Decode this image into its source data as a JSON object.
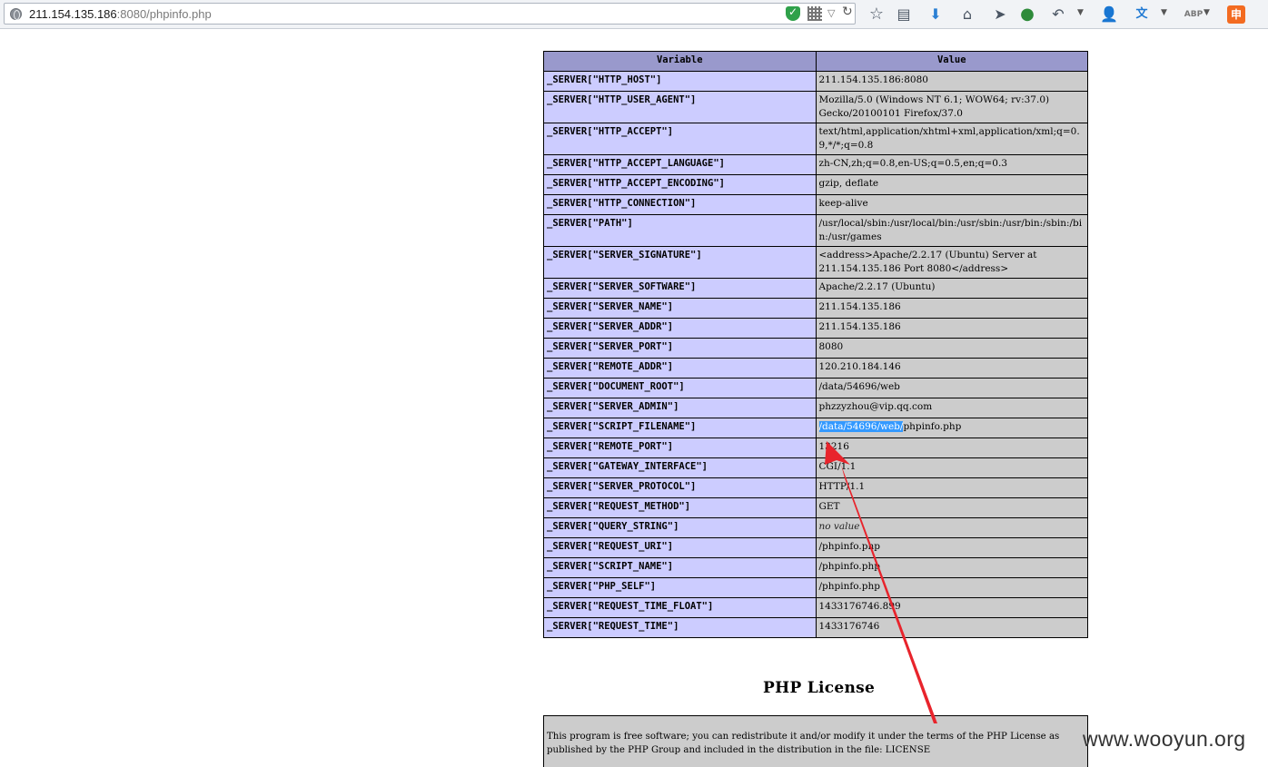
{
  "browser": {
    "url_host": "211.154.135.186",
    "url_rest": ":8080/phpinfo.php"
  },
  "server_table": {
    "headers": [
      "Variable",
      "Value"
    ],
    "rows": [
      {
        "var": "_SERVER[\"HTTP_HOST\"]",
        "val": "211.154.135.186:8080"
      },
      {
        "var": "_SERVER[\"HTTP_USER_AGENT\"]",
        "val": "Mozilla/5.0 (Windows NT 6.1; WOW64; rv:37.0) Gecko/20100101 Firefox/37.0"
      },
      {
        "var": "_SERVER[\"HTTP_ACCEPT\"]",
        "val": "text/html,application/xhtml+xml,application/xml;q=0.9,*/*;q=0.8"
      },
      {
        "var": "_SERVER[\"HTTP_ACCEPT_LANGUAGE\"]",
        "val": "zh-CN,zh;q=0.8,en-US;q=0.5,en;q=0.3"
      },
      {
        "var": "_SERVER[\"HTTP_ACCEPT_ENCODING\"]",
        "val": "gzip, deflate"
      },
      {
        "var": "_SERVER[\"HTTP_CONNECTION\"]",
        "val": "keep-alive"
      },
      {
        "var": "_SERVER[\"PATH\"]",
        "val": "/usr/local/sbin:/usr/local/bin:/usr/sbin:/usr/bin:/sbin:/bin:/usr/games"
      },
      {
        "var": "_SERVER[\"SERVER_SIGNATURE\"]",
        "val": "<address>Apache/2.2.17 (Ubuntu) Server at 211.154.135.186 Port 8080</address>"
      },
      {
        "var": "_SERVER[\"SERVER_SOFTWARE\"]",
        "val": "Apache/2.2.17 (Ubuntu)"
      },
      {
        "var": "_SERVER[\"SERVER_NAME\"]",
        "val": "211.154.135.186"
      },
      {
        "var": "_SERVER[\"SERVER_ADDR\"]",
        "val": "211.154.135.186"
      },
      {
        "var": "_SERVER[\"SERVER_PORT\"]",
        "val": "8080"
      },
      {
        "var": "_SERVER[\"REMOTE_ADDR\"]",
        "val": "120.210.184.146"
      },
      {
        "var": "_SERVER[\"DOCUMENT_ROOT\"]",
        "val": "/data/54696/web"
      },
      {
        "var": "_SERVER[\"SERVER_ADMIN\"]",
        "val": "phzzyzhou@vip.qq.com"
      },
      {
        "var": "_SERVER[\"SCRIPT_FILENAME\"]",
        "val_selected": "/data/54696/web/",
        "val_rest": "phpinfo.php"
      },
      {
        "var": "_SERVER[\"REMOTE_PORT\"]",
        "val": "13216"
      },
      {
        "var": "_SERVER[\"GATEWAY_INTERFACE\"]",
        "val": "CGI/1.1"
      },
      {
        "var": "_SERVER[\"SERVER_PROTOCOL\"]",
        "val": "HTTP/1.1"
      },
      {
        "var": "_SERVER[\"REQUEST_METHOD\"]",
        "val": "GET"
      },
      {
        "var": "_SERVER[\"QUERY_STRING\"]",
        "val_italic": "no value"
      },
      {
        "var": "_SERVER[\"REQUEST_URI\"]",
        "val": "/phpinfo.php"
      },
      {
        "var": "_SERVER[\"SCRIPT_NAME\"]",
        "val": "/phpinfo.php"
      },
      {
        "var": "_SERVER[\"PHP_SELF\"]",
        "val": "/phpinfo.php"
      },
      {
        "var": "_SERVER[\"REQUEST_TIME_FLOAT\"]",
        "val": "1433176746.899"
      },
      {
        "var": "_SERVER[\"REQUEST_TIME\"]",
        "val": "1433176746"
      }
    ]
  },
  "license": {
    "title": "PHP License",
    "text": "This program is free software; you can redistribute it and/or modify it under the terms of the PHP License as published by the PHP Group and included in the distribution in the file: LICENSE"
  },
  "watermark": "www.wooyun.org",
  "colors": {
    "header_bg": "#9999cc",
    "var_bg": "#ccccff",
    "val_bg": "#cccccc",
    "selection": "#3399ff",
    "arrow": "#e8242c"
  },
  "icons": [
    "globe-icon",
    "shield-icon",
    "qr-code-icon",
    "dropmarker-icon",
    "reload-icon",
    "bookmark-star-icon",
    "reading-list-icon",
    "download-icon",
    "home-icon",
    "send-icon",
    "green-ball-icon",
    "undo-icon",
    "user-icon",
    "translate-icon",
    "adblock-icon",
    "extension-icon"
  ]
}
